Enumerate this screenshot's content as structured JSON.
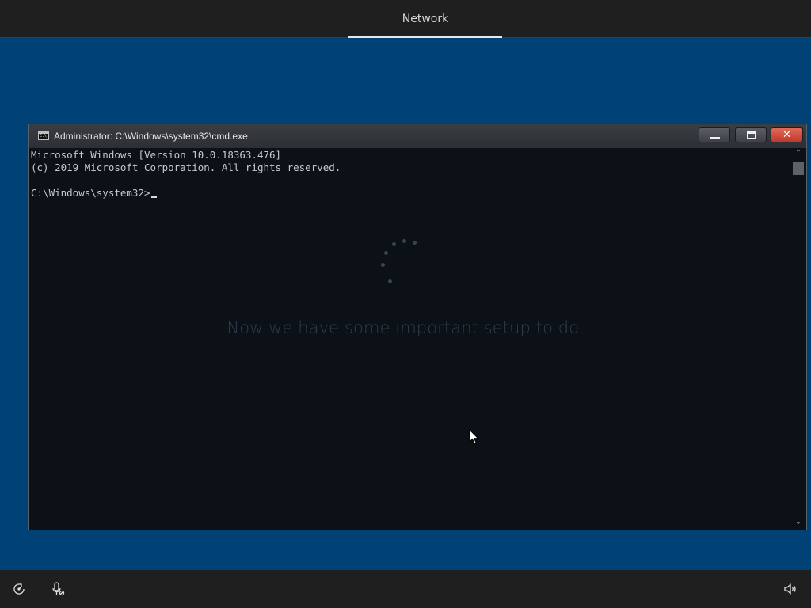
{
  "header": {
    "active_tab": "Network"
  },
  "cmd_window": {
    "title": "Administrator: C:\\Windows\\system32\\cmd.exe",
    "lines": [
      "Microsoft Windows [Version 10.0.18363.476]",
      "(c) 2019 Microsoft Corporation. All rights reserved.",
      "",
      "C:\\Windows\\system32>"
    ],
    "buttons": {
      "minimize_icon": "minimize-icon",
      "maximize_icon": "maximize-icon",
      "close_icon": "close-icon"
    }
  },
  "setup": {
    "message": "Now we have some important setup to do."
  },
  "taskbar": {
    "icons": [
      "ease-of-access-icon",
      "microphone-icon",
      "volume-icon"
    ]
  },
  "colors": {
    "desktop_blue": "#004275",
    "header_bar": "#1f1f1f",
    "console_bg": "#0c1118",
    "close_red": "#c2382a"
  }
}
